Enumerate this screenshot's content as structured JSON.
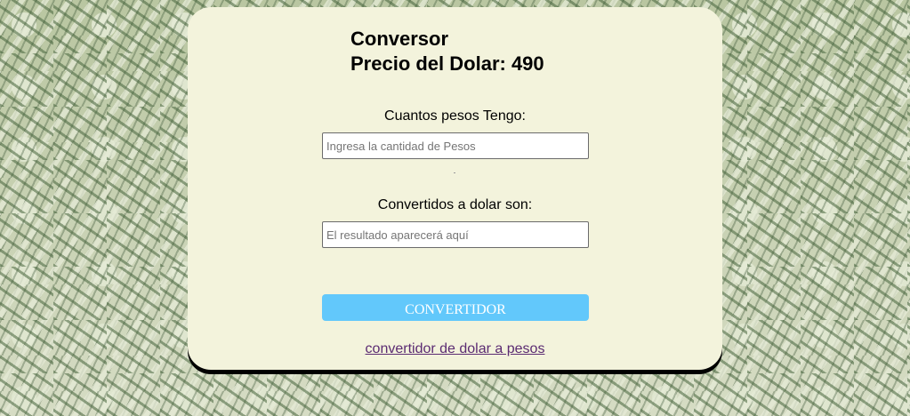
{
  "header": {
    "title_line1": "Conversor",
    "title_line2": "Precio del Dolar: 490"
  },
  "form": {
    "pesos_label": "Cuantos pesos Tengo:",
    "pesos_placeholder": "Ingresa la cantidad de Pesos",
    "result_label": "Convertidos a dolar son:",
    "result_placeholder": "El resultado aparecerá aquí",
    "button_label": "CONVERTIDOR"
  },
  "footer": {
    "link_text": "convertidor de dolar a pesos"
  },
  "colors": {
    "card_background": "#f3f3dc",
    "button_background": "#62c8fb",
    "link_color": "#5b2b72"
  }
}
